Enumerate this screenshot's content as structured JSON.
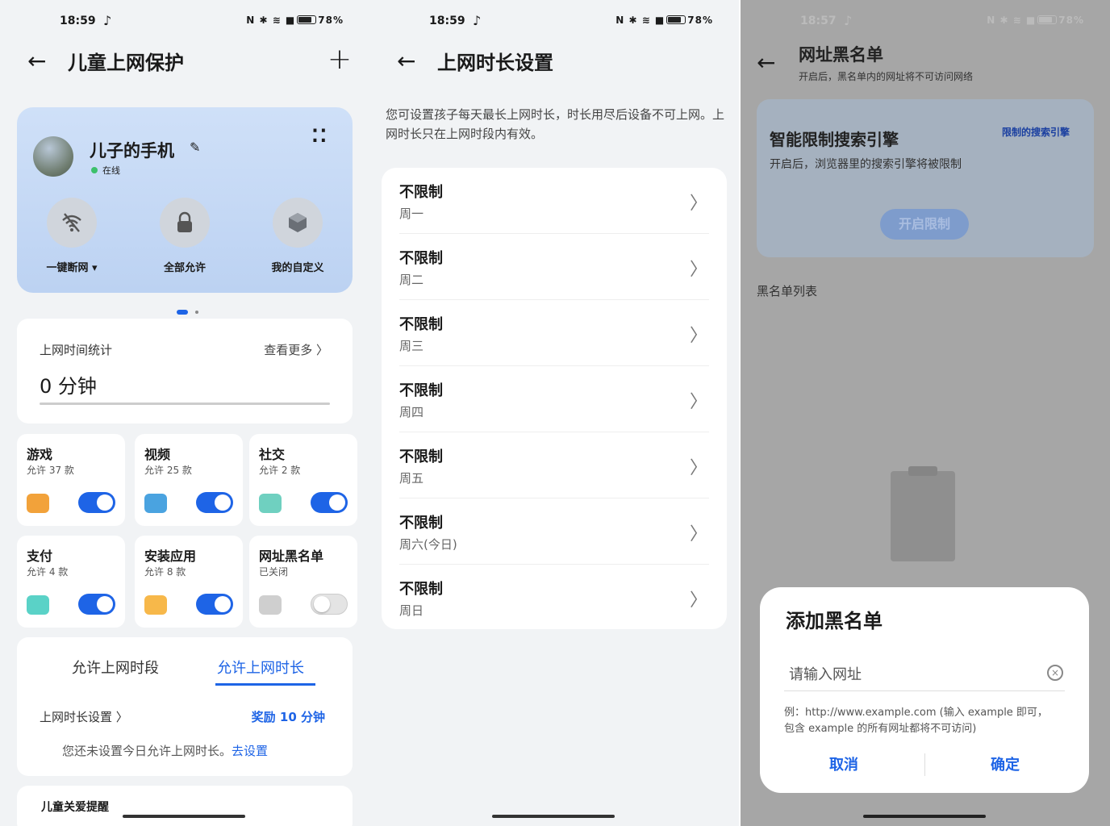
{
  "panel1": {
    "status": {
      "time": "18:59",
      "icons": "N ✱ ≋ ■",
      "battery": "78%"
    },
    "nav": {
      "back": "←",
      "title": "儿童上网保护",
      "add": "+"
    },
    "device": {
      "name": "儿子的手机",
      "edit": "✎",
      "online": "在线",
      "more": "⁚⁚"
    },
    "actions": [
      {
        "label": "一键断网 ▾",
        "icon": "wifi-off-icon"
      },
      {
        "label": "全部允许",
        "icon": "lock-icon"
      },
      {
        "label": "我的自定义",
        "icon": "cube-icon"
      }
    ],
    "usage": {
      "title": "上网时间统计",
      "more": "查看更多 〉",
      "value": "0 分钟"
    },
    "categories": [
      {
        "title": "游戏",
        "sub": "允许 37 款",
        "on": true,
        "color": "#f2a23a"
      },
      {
        "title": "视频",
        "sub": "允许 25 款",
        "on": true,
        "color": "#4aa3e0"
      },
      {
        "title": "社交",
        "sub": "允许 2 款",
        "on": true,
        "color": "#6fd0c0"
      },
      {
        "title": "支付",
        "sub": "允许 4 款",
        "on": true,
        "color": "#5ad2c7"
      },
      {
        "title": "安装应用",
        "sub": "允许 8 款",
        "on": true,
        "color": "#f7b84a"
      },
      {
        "title": "网址黑名单",
        "sub": "已关闭",
        "on": false,
        "color": "#cfcfcf"
      }
    ],
    "tabs": {
      "tab1": "允许上网时段",
      "tab2": "允许上网时长",
      "setting": "上网时长设置 〉",
      "reward": "奖励 10 分钟",
      "hint": "您还未设置今日允许上网时长。",
      "hint_link": "去设置"
    },
    "peek": "儿童关爱提醒"
  },
  "panel2": {
    "status": {
      "time": "18:59",
      "icons": "N ✱ ≋ ■",
      "battery": "78%"
    },
    "nav": {
      "back": "←",
      "title": "上网时长设置"
    },
    "desc": "您可设置孩子每天最长上网时长，时长用尽后设备不可上网。上网时长只在上网时段内有效。",
    "days": [
      {
        "value": "不限制",
        "day": "周一"
      },
      {
        "value": "不限制",
        "day": "周二"
      },
      {
        "value": "不限制",
        "day": "周三"
      },
      {
        "value": "不限制",
        "day": "周四"
      },
      {
        "value": "不限制",
        "day": "周五"
      },
      {
        "value": "不限制",
        "day": "周六(今日)"
      },
      {
        "value": "不限制",
        "day": "周日"
      }
    ],
    "chevron": "〉"
  },
  "panel3": {
    "status": {
      "time": "18:57",
      "icons": "N ✱ ≋ ■",
      "battery": "78%"
    },
    "nav": {
      "back": "←",
      "title": "网址黑名单",
      "sub": "开启后，黑名单内的网址将不可访问网络"
    },
    "engine": {
      "title": "智能限制搜索引擎",
      "link": "限制的搜索引擎",
      "desc": "开启后，浏览器里的搜索引擎将被限制",
      "button": "开启限制"
    },
    "list_title": "黑名单列表",
    "dialog": {
      "title": "添加黑名单",
      "placeholder": "请输入网址",
      "clear": "×",
      "example": "例：http://www.example.com (输入 example 即可，包含 example 的所有网址都将不可访问)",
      "cancel": "取消",
      "confirm": "确定"
    }
  }
}
